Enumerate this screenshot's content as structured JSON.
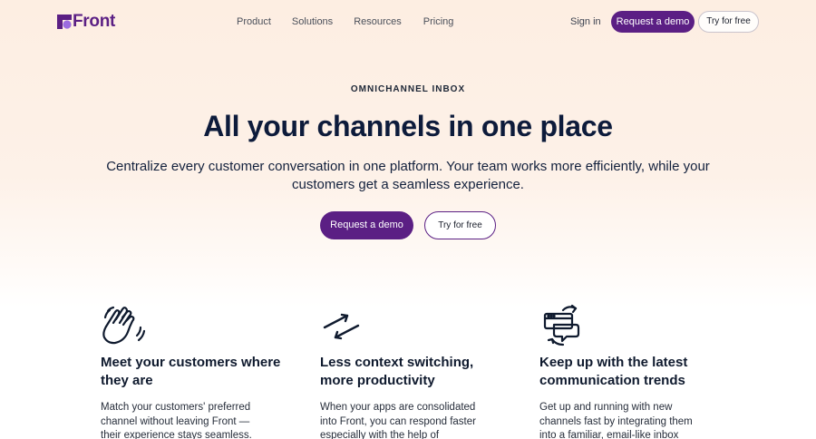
{
  "nav": {
    "logo_text": "Front",
    "links": [
      "Product",
      "Solutions",
      "Resources",
      "Pricing"
    ],
    "sign_in": "Sign in",
    "demo_button": "Request a demo",
    "try_button": "Try for free"
  },
  "hero": {
    "eyebrow": "OMNICHANNEL INBOX",
    "title": "All your channels in one place",
    "subtitle": "Centralize every customer conversation in one platform. Your team works more efficiently, while your customers get a seamless experience.",
    "demo_button": "Request a demo",
    "try_button": "Try for free"
  },
  "features": [
    {
      "icon": "waving-hands-icon",
      "title": "Meet your customers where they are",
      "body": "Match your customers' preferred channel without leaving Front — their experience stays seamless."
    },
    {
      "icon": "swap-arrows-icon",
      "title": "Less context switching, more productivity",
      "body": "When your apps are consolidated into Front, you can respond faster especially with the help of automated"
    },
    {
      "icon": "channel-sync-icon",
      "title": "Keep up with the latest communication trends",
      "body": "Get up and running with new channels fast by integrating them into a familiar, email-like inbox experience."
    }
  ],
  "colors": {
    "brand": "#5B1F84",
    "heading": "#0D1B3B",
    "bg_top": "#FDEEE2"
  }
}
